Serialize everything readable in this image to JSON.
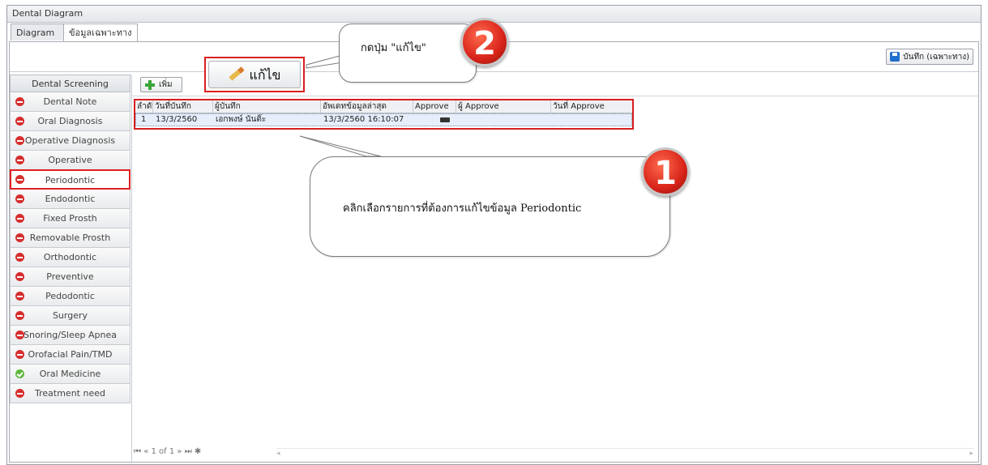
{
  "window": {
    "title": "Dental Diagram"
  },
  "tabs": [
    {
      "label": "Diagram",
      "active": false
    },
    {
      "label": "ข้อมูลเฉพาะทาง",
      "active": true
    }
  ],
  "toolbar": {
    "save_label": "บันทึก (เฉพาะทาง)",
    "add_label": "เพิ่ม"
  },
  "sidebar": {
    "header": "Dental Screening",
    "items": [
      {
        "label": "Dental Note",
        "status": "incomplete"
      },
      {
        "label": "Oral Diagnosis",
        "status": "incomplete"
      },
      {
        "label": "Operative Diagnosis",
        "status": "incomplete"
      },
      {
        "label": "Operative",
        "status": "incomplete"
      },
      {
        "label": "Periodontic",
        "status": "incomplete",
        "selected": true
      },
      {
        "label": "Endodontic",
        "status": "incomplete"
      },
      {
        "label": "Fixed Prosth",
        "status": "incomplete"
      },
      {
        "label": "Removable Prosth",
        "status": "incomplete"
      },
      {
        "label": "Orthodontic",
        "status": "incomplete"
      },
      {
        "label": "Preventive",
        "status": "incomplete"
      },
      {
        "label": "Pedodontic",
        "status": "incomplete"
      },
      {
        "label": "Surgery",
        "status": "incomplete"
      },
      {
        "label": "Snoring/Sleep Apnea",
        "status": "incomplete"
      },
      {
        "label": "Orofacial Pain/TMD",
        "status": "incomplete"
      },
      {
        "label": "Oral Medicine",
        "status": "complete"
      },
      {
        "label": "Treatment need",
        "status": "incomplete"
      }
    ]
  },
  "grid": {
    "columns": [
      "ลำดับ",
      "วันที่บันทึก",
      "ผู้บันทึก",
      "อัพเดทข้อมูลล่าสุด",
      "Approve",
      "ผู้ Approve",
      "วันที่ Approve"
    ],
    "rows": [
      {
        "no": "1",
        "date": "13/3/2560",
        "recorder": "เอกพงษ์ นันติ๊ะ",
        "updated": "13/3/2560 16:10:07",
        "approve_icon": "toggle-icon",
        "approver": "",
        "approve_date": ""
      }
    ]
  },
  "pager": {
    "text": "1 of 1"
  },
  "annotations": {
    "edit_button_label": "แก้ไข",
    "step2_text": "กดปุ่ม \"แก้ไข\"",
    "step2_number": "2",
    "step1_text": "คลิกเลือกรายการที่ต้องการแก้ไขข้อมูล Periodontic",
    "step1_number": "1",
    "highlight_color": "#d81e1e",
    "badge_color": "#d8241a"
  },
  "colors": {
    "incomplete": "#d62d2d",
    "complete": "#5cb83a",
    "selected_row": "#e6eefb"
  }
}
